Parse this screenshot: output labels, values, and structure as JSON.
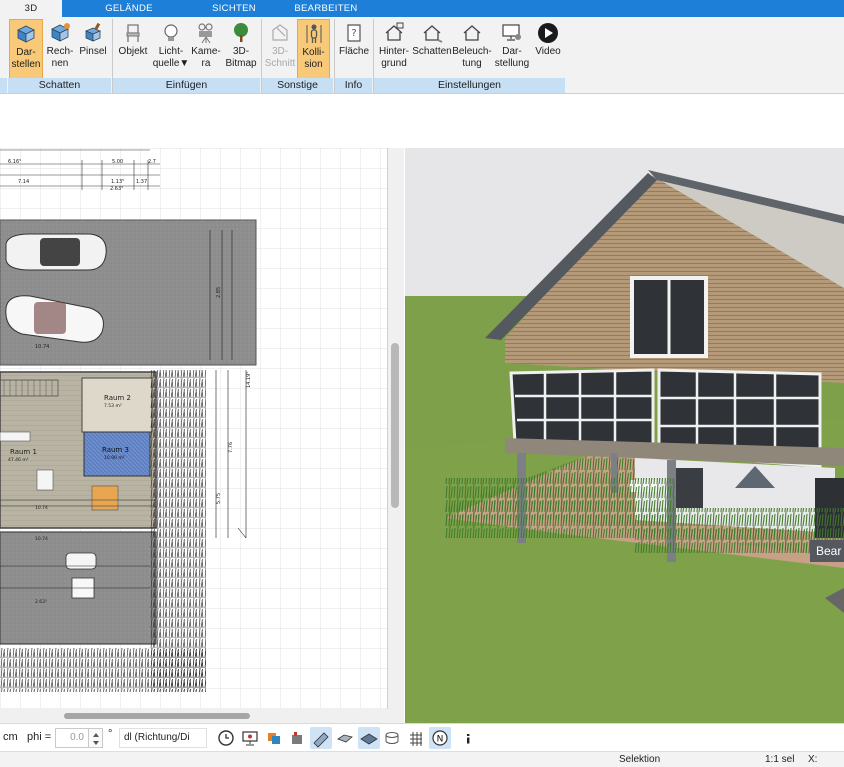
{
  "tabs": [
    {
      "label": "3D",
      "active": true
    },
    {
      "label": "GELÄNDE",
      "active": false
    },
    {
      "label": "SICHTEN",
      "active": false
    },
    {
      "label": "BEARBEITEN",
      "active": false
    }
  ],
  "ribbon": {
    "groups": [
      {
        "label": "Schatten"
      },
      {
        "label": "Einfügen"
      },
      {
        "label": "Sonstige"
      },
      {
        "label": "Info"
      },
      {
        "label": "Einstellungen"
      }
    ],
    "buttons": {
      "darstellen": {
        "line1": "Dar-",
        "line2": "stellen",
        "icon": "cube-icon"
      },
      "rechnen": {
        "line1": "Rech-",
        "line2": "nen",
        "icon": "cube-compute-icon"
      },
      "pinsel": {
        "line1": "Pinsel",
        "line2": "",
        "icon": "brush-cube-icon"
      },
      "objekt": {
        "line1": "Objekt",
        "line2": "",
        "icon": "chair-icon"
      },
      "lichtquelle": {
        "line1": "Licht-",
        "line2": "quelle",
        "icon": "lightbulb-icon",
        "dropdown": "▼"
      },
      "kamera": {
        "line1": "Kame-",
        "line2": "ra",
        "icon": "camera-icon"
      },
      "bitmap": {
        "line1": "3D-",
        "line2": "Bitmap",
        "icon": "tree-icon"
      },
      "schnitt": {
        "line1": "3D-",
        "line2": "Schnitt",
        "icon": "section-icon"
      },
      "kollision": {
        "line1": "Kolli-",
        "line2": "sion",
        "icon": "person-icon"
      },
      "flaeche": {
        "line1": "Fläche",
        "line2": "",
        "icon": "area-info-icon"
      },
      "hintergrund": {
        "line1": "Hinter-",
        "line2": "grund",
        "icon": "house-background-icon"
      },
      "schatten": {
        "line1": "Schatten",
        "line2": "",
        "icon": "house-shadow-icon"
      },
      "beleuchtung": {
        "line1": "Beleuch-",
        "line2": "tung",
        "icon": "house-light-icon"
      },
      "darstellung": {
        "line1": "Dar-",
        "line2": "stellung",
        "icon": "monitor-settings-icon"
      },
      "video": {
        "line1": "Video",
        "line2": "",
        "icon": "play-icon"
      }
    }
  },
  "plan": {
    "dims_top": [
      "6.16⁵",
      "5.00",
      "2.7",
      "7.14",
      "1.13⁵",
      "1.37",
      "2.63⁵"
    ],
    "garage_width": "10.74",
    "rooms": [
      {
        "name": "Raum 1",
        "area": "47.46 m²"
      },
      {
        "name": "Raum 2",
        "area": "7.53 m²"
      },
      {
        "name": "Raum 3",
        "area": "10.90 m²"
      }
    ],
    "side_dims": [
      "14.19⁵",
      "7.76",
      "5.75",
      "2.85"
    ],
    "lower_dims": [
      "10.74",
      "10.74",
      "2.63⁵"
    ]
  },
  "tooltip": {
    "text": "Bear"
  },
  "bottombar": {
    "unit": "cm",
    "phi_label": "phi =",
    "phi_value": "0.0",
    "degree": "°",
    "direction": "dl (Richtung/Di"
  },
  "status": {
    "mode": "Selektion",
    "scale": "1:1 sel",
    "coord": "X:"
  },
  "colors": {
    "tabbar": "#1e7fd8",
    "ribbon_bg": "#f2f2f2",
    "group_label_bg": "#c6dff4",
    "active_button": "#f7c978",
    "sky": "#e6e6e9",
    "lawn": "#7fa04a"
  }
}
